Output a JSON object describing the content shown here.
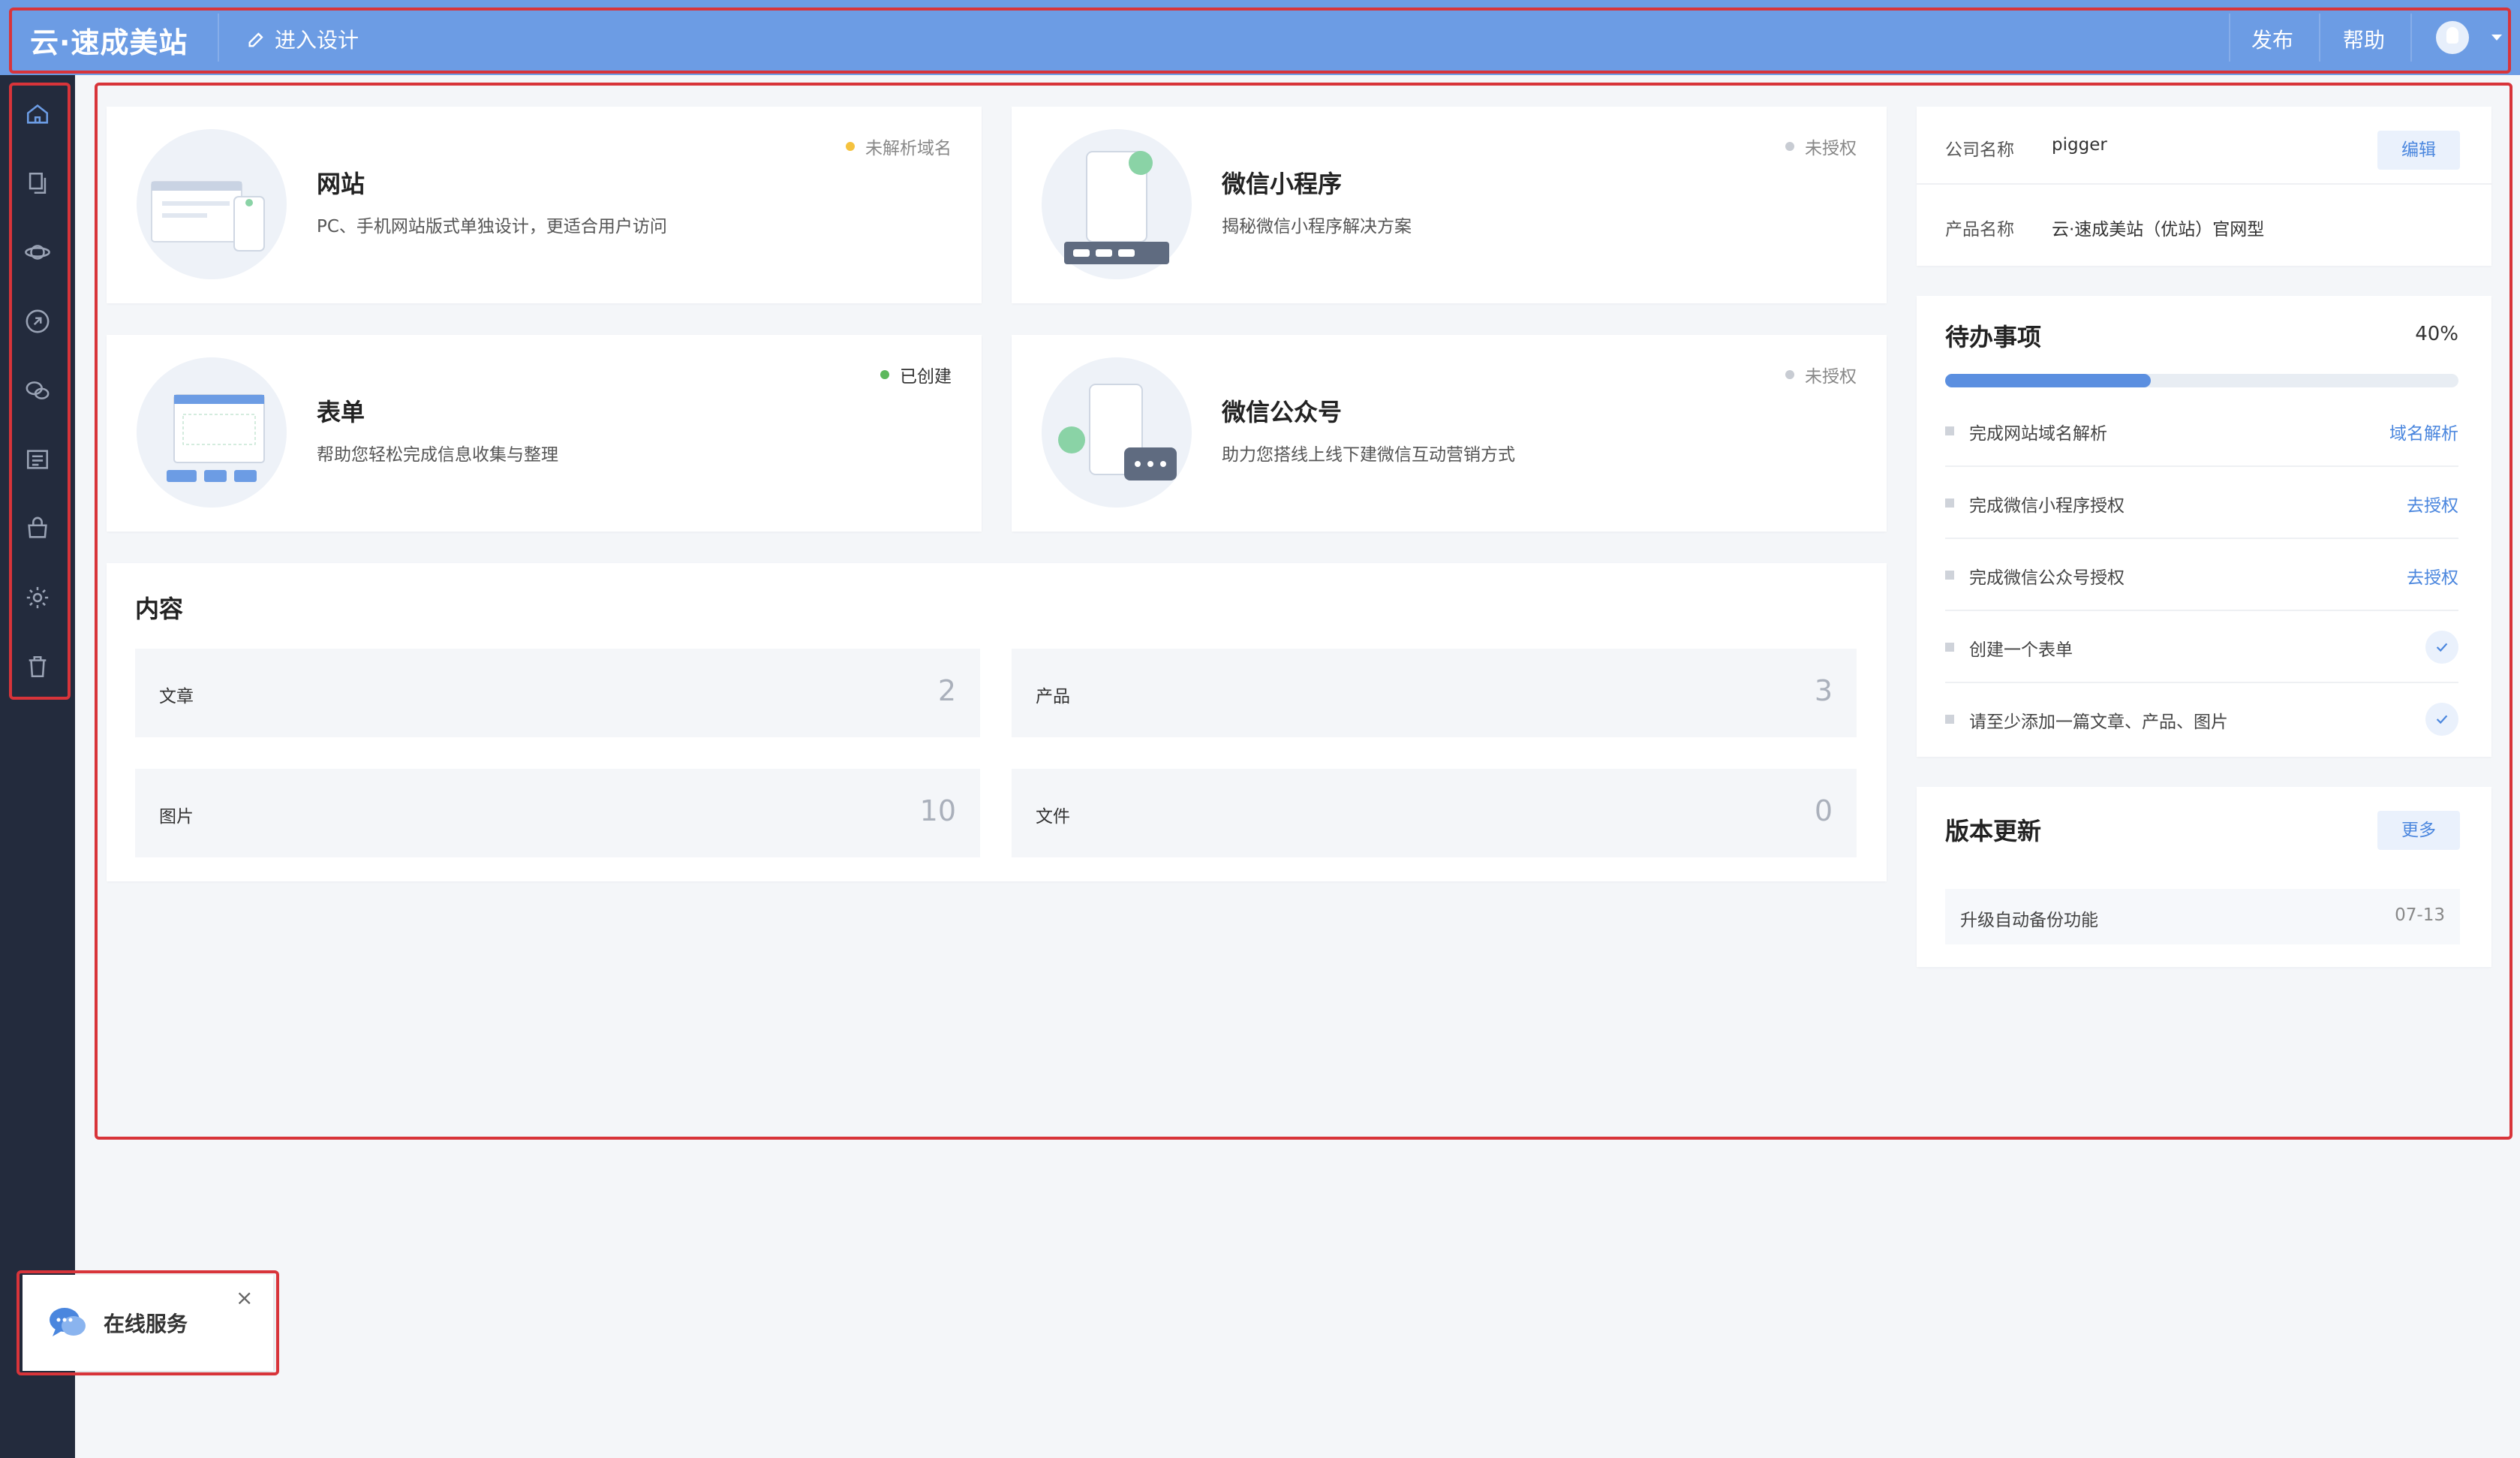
{
  "header": {
    "logo": "云·速成美站",
    "design_label": "进入设计",
    "publish_label": "发布",
    "help_label": "帮助"
  },
  "sidebar": {
    "items": [
      "home-icon",
      "pages-icon",
      "planet-icon",
      "link-icon",
      "wechat-icon",
      "list-icon",
      "shop-icon",
      "settings-icon",
      "trash-icon"
    ]
  },
  "features": [
    {
      "title": "网站",
      "desc": "PC、手机网站版式单独设计，更适合用户访问",
      "status": "未解析域名",
      "status_color": "#f5c23e"
    },
    {
      "title": "微信小程序",
      "desc": "揭秘微信小程序解决方案",
      "status": "未授权",
      "status_color": "#c8ccd3"
    },
    {
      "title": "表单",
      "desc": "帮助您轻松完成信息收集与整理",
      "status": "已创建",
      "status_color": "#5cb85c"
    },
    {
      "title": "微信公众号",
      "desc": "助力您搭线上线下建微信互动营销方式",
      "status": "未授权",
      "status_color": "#c8ccd3"
    }
  ],
  "content": {
    "title": "内容",
    "stats": [
      {
        "label": "文章",
        "value": "2"
      },
      {
        "label": "产品",
        "value": "3"
      },
      {
        "label": "图片",
        "value": "10"
      },
      {
        "label": "文件",
        "value": "0"
      }
    ]
  },
  "company": {
    "name_key": "公司名称",
    "name_value": "pigger",
    "edit_label": "编辑",
    "product_key": "产品名称",
    "product_value": "云·速成美站（优站）官网型"
  },
  "todo": {
    "title": "待办事项",
    "percent_label": "40%",
    "progress": 0.4,
    "items": [
      {
        "text": "完成网站域名解析",
        "action": "域名解析"
      },
      {
        "text": "完成微信小程序授权",
        "action": "去授权"
      },
      {
        "text": "完成微信公众号授权",
        "action": "去授权"
      },
      {
        "text": "创建一个表单",
        "action": ""
      },
      {
        "text": "请至少添加一篇文章、产品、图片",
        "action": ""
      }
    ]
  },
  "updates": {
    "title": "版本更新",
    "more_label": "更多",
    "items": [
      {
        "text": "升级自动备份功能",
        "date": "07-13"
      }
    ]
  },
  "chat": {
    "label": "在线服务",
    "close": "×"
  },
  "colors": {
    "header": "#6c9ce4",
    "sidebar": "#232b3d",
    "accent": "#4a86de",
    "highlight": "#d8343a"
  }
}
